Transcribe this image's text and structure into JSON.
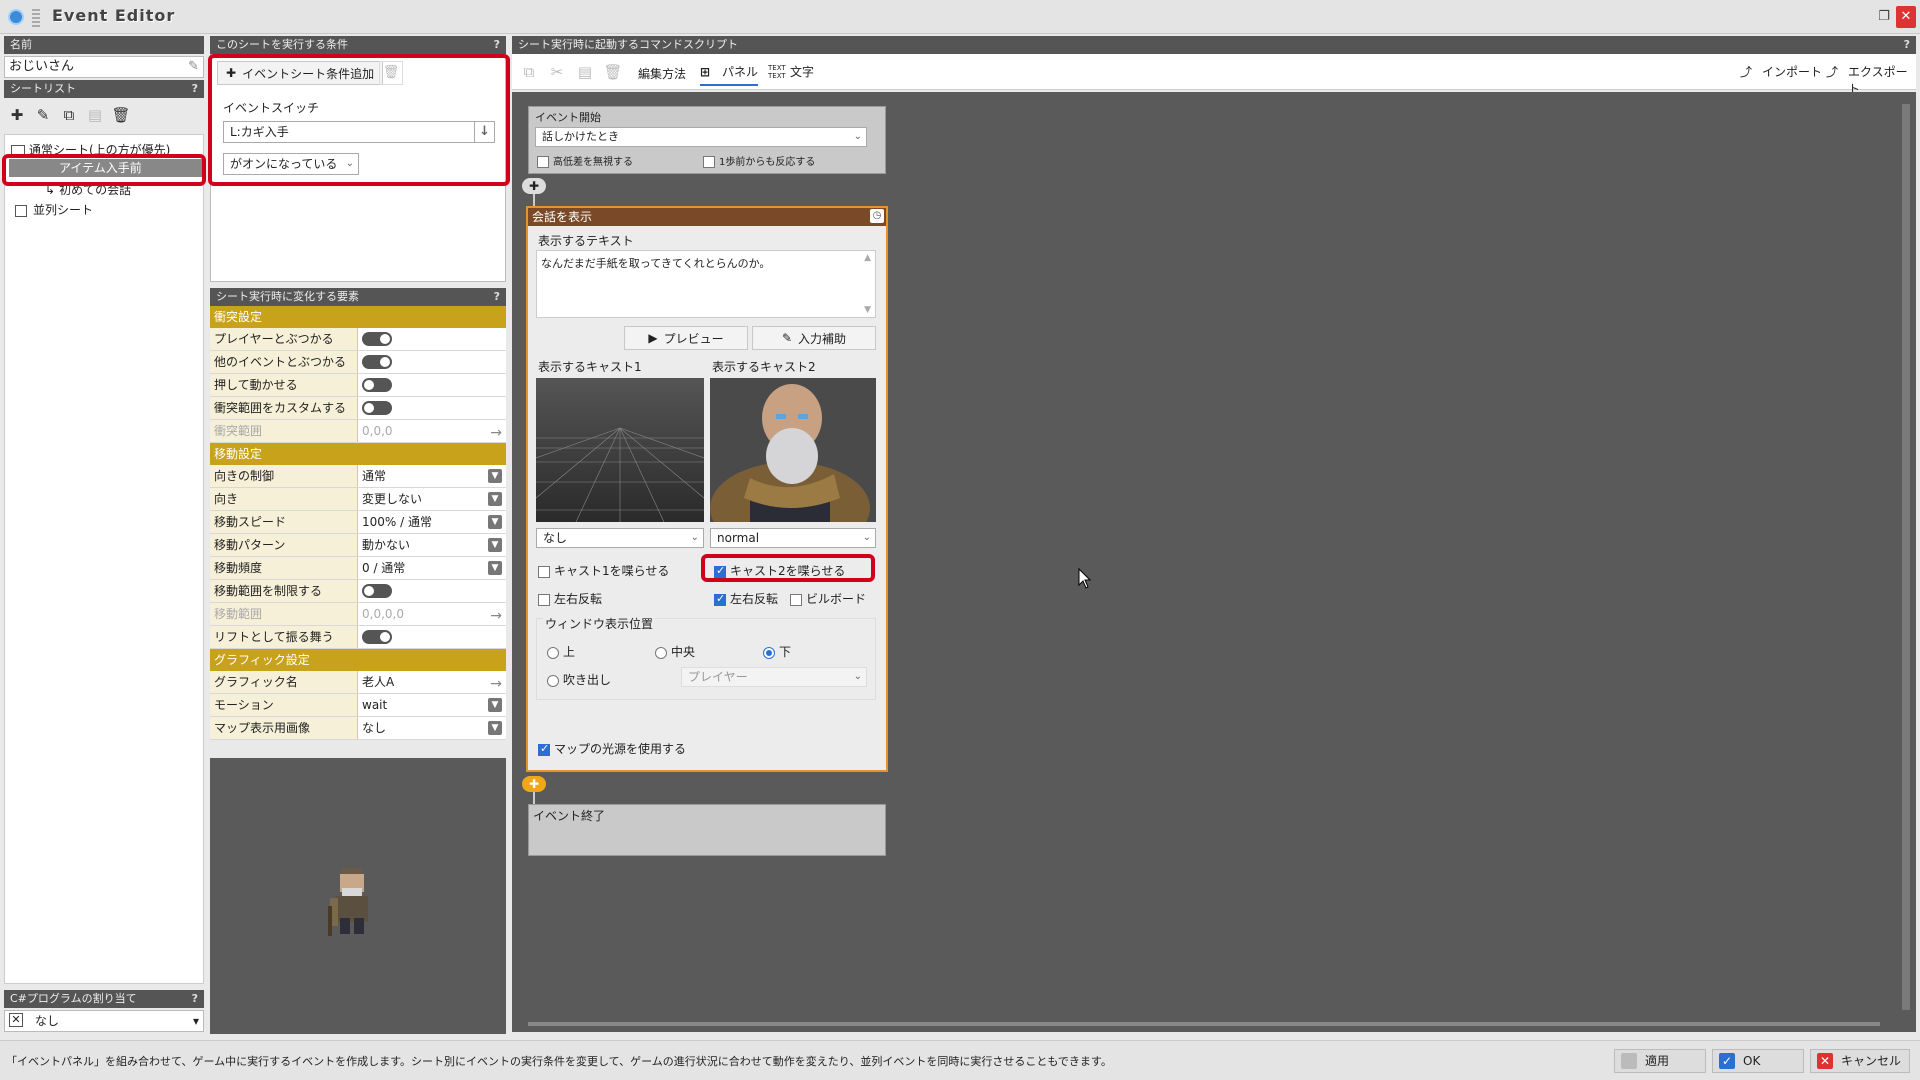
{
  "window": {
    "title": "Event Editor"
  },
  "left": {
    "name_label": "名前",
    "name_value": "おじいさん",
    "sheetlist_label": "シートリスト",
    "help": "?",
    "tree": [
      {
        "label": "通常シート(上の方が優先)"
      },
      {
        "label": "アイテム入手前"
      },
      {
        "label": "初めての会話"
      },
      {
        "label": "並列シート"
      }
    ],
    "csharp_label": "C#プログラムの割り当て",
    "csharp_value": "なし"
  },
  "conditions": {
    "header": "このシートを実行する条件",
    "add_button": "イベントシート条件追加",
    "switch_label": "イベントスイッチ",
    "switch_value": "L:カギ入手",
    "state_value": "がオンになっている"
  },
  "props": {
    "header": "シート実行時に変化する要素",
    "sections": [
      {
        "title": "衝突設定",
        "rows": [
          {
            "k": "プレイヤーとぶつかる",
            "type": "toggle",
            "on": true
          },
          {
            "k": "他のイベントとぶつかる",
            "type": "toggle",
            "on": true
          },
          {
            "k": "押して動かせる",
            "type": "toggle",
            "on": false
          },
          {
            "k": "衝突範囲をカスタムする",
            "type": "toggle",
            "on": false
          },
          {
            "k": "衝突範囲",
            "type": "arrow",
            "v": "0,0,0",
            "disabled": true
          }
        ]
      },
      {
        "title": "移動設定",
        "rows": [
          {
            "k": "向きの制御",
            "type": "drop",
            "v": "通常"
          },
          {
            "k": "向き",
            "type": "drop",
            "v": "変更しない"
          },
          {
            "k": "移動スピード",
            "type": "drop",
            "v": "100% / 通常"
          },
          {
            "k": "移動パターン",
            "type": "drop",
            "v": "動かない"
          },
          {
            "k": "移動頻度",
            "type": "drop",
            "v": "0 / 通常"
          },
          {
            "k": "移動範囲を制限する",
            "type": "toggle",
            "on": false
          },
          {
            "k": "移動範囲",
            "type": "arrow",
            "v": "0,0,0,0",
            "disabled": true
          },
          {
            "k": "リフトとして振る舞う",
            "type": "toggle",
            "on": true
          }
        ]
      },
      {
        "title": "グラフィック設定",
        "rows": [
          {
            "k": "グラフィック名",
            "type": "arrow",
            "v": "老人A"
          },
          {
            "k": "モーション",
            "type": "drop",
            "v": "wait"
          },
          {
            "k": "マップ表示用画像",
            "type": "drop",
            "v": "なし"
          }
        ]
      }
    ]
  },
  "script": {
    "header": "シート実行時に起動するコマンドスクリプト",
    "edit_method": "編集方法",
    "mode_panel": "パネル",
    "mode_text": "文字",
    "import": "インポート",
    "export": "エクスポート",
    "event_start": {
      "label": "イベント開始",
      "trigger": "話しかけたとき",
      "ignore_height": "高低差を無視する",
      "one_step": "1歩前からも反応する"
    },
    "dialog": {
      "title": "会話を表示",
      "text_label": "表示するテキスト",
      "text": "なんだまだ手紙を取ってきてくれとらんのか。",
      "preview": "プレビュー",
      "input_assist": "入力補助",
      "cast1_label": "表示するキャスト1",
      "cast2_label": "表示するキャスト2",
      "cast1_value": "なし",
      "cast2_value": "normal",
      "cast1_speak": "キャスト1を喋らせる",
      "cast2_speak": "キャスト2を喋らせる",
      "flip1": "左右反転",
      "flip2": "左右反転",
      "billboard": "ビルボード",
      "window_pos_label": "ウィンドウ表示位置",
      "pos_top": "上",
      "pos_mid": "中央",
      "pos_bottom": "下",
      "pos_balloon": "吹き出し",
      "balloon_target": "プレイヤー",
      "use_light": "マップの光源を使用する"
    },
    "event_end": "イベント終了"
  },
  "status": {
    "text": "「イベントパネル」を組み合わせて、ゲーム中に実行するイベントを作成します。シート別にイベントの実行条件を変更して、ゲームの進行状況に合わせて動作を変えたり、並列イベントを同時に実行させることもできます。",
    "apply": "適用",
    "ok": "OK",
    "cancel": "キャンセル"
  }
}
